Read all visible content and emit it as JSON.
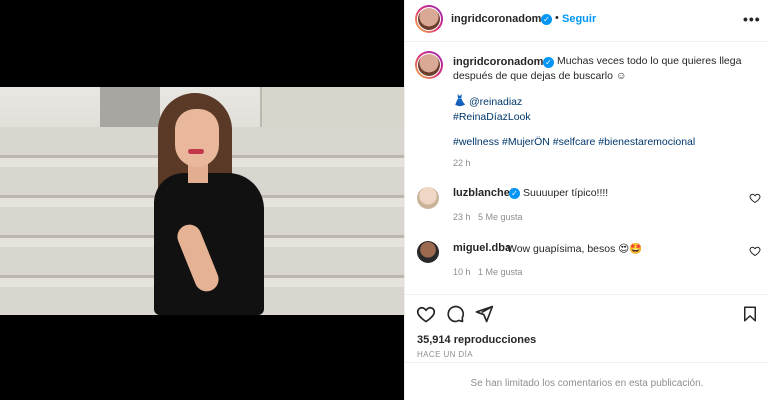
{
  "post": {
    "author": "ingridcoronadomx",
    "follow_label": "Seguir",
    "more_label": "•••",
    "separator": "•"
  },
  "caption": {
    "author": "ingridcoronadomx",
    "line1": "Muchas veces todo lo que quieres llega",
    "line2": "después de que dejas de buscarlo ☺",
    "mention": "@reinadiaz",
    "tag_look": "#ReinaDíazLook",
    "hashtags": "#wellness #MujerÖN #selfcare #bienestaremocional",
    "time": "22 h"
  },
  "comments": [
    {
      "user": "luzblanchet",
      "text": "Suuuuper típico!!!!",
      "time": "23 h",
      "likes": "5 Me gusta"
    },
    {
      "user": "miguel.dba",
      "text": "Wow guapísima, besos 😍🤩",
      "time": "10 h",
      "likes": "1 Me gusta"
    }
  ],
  "stats": {
    "views": "35,914 reproducciones",
    "ago": "HACE UN DÍA"
  },
  "footer": {
    "limited": "Se han limitado los comentarios en esta publicación."
  },
  "icons": {
    "like": "heart-icon",
    "comment": "comment-icon",
    "share": "paper-plane-icon",
    "save": "bookmark-icon",
    "mention_icon": "dress-emoji"
  },
  "colors": {
    "link": "#0095f6",
    "hashtag": "#00376b",
    "muted": "#8e8e8e"
  }
}
